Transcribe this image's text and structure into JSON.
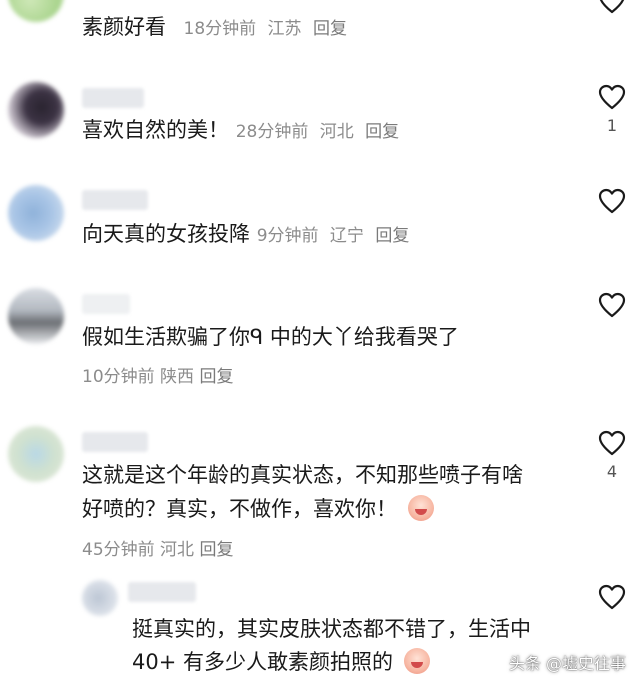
{
  "comments": [
    {
      "text": "素颜好看",
      "time": "18分钟前",
      "location": "江苏",
      "reply": "回复",
      "likes": ""
    },
    {
      "text": "喜欢自然的美！",
      "time": "28分钟前",
      "location": "河北",
      "reply": "回复",
      "likes": "1"
    },
    {
      "text": "向天真的女孩投降",
      "time": "9分钟前",
      "location": "辽宁",
      "reply": "回复",
      "likes": ""
    },
    {
      "text": "假如生活欺骗了你ᑫ 中的大丫给我看哭了",
      "time": "10分钟前",
      "location": "陕西",
      "reply": "回复",
      "likes": ""
    },
    {
      "text_line1": "这就是这个年龄的真实状态，不知那些喷子有啥",
      "text_line2": "好喷的？真实，不做作，喜欢你！",
      "time": "45分钟前",
      "location": "河北",
      "reply": "回复",
      "likes": "4"
    },
    {
      "text_line1": "挺真实的，其实皮肤状态都不错了，生活中",
      "text_line2": "40+ 有多少人敢素颜拍照的",
      "likes": ""
    }
  ],
  "icons": {
    "like": "heart-outline-icon",
    "emoji": "crying-face-emoji-icon",
    "avatar": "blurred-avatar"
  },
  "watermark": "头条 @墟史往事",
  "colors": {
    "text": "#1a1a1a",
    "meta": "#8c8c8c",
    "background": "#ffffff"
  }
}
